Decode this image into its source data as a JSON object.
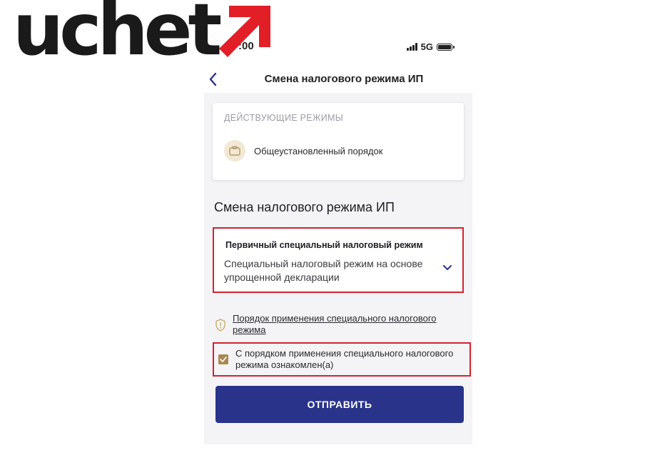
{
  "logo": {
    "text": "uchet",
    "arrow_color": "#e21e26",
    "text_color": "#1a1a1a"
  },
  "status_bar": {
    "time": ":00",
    "network": "5G"
  },
  "nav": {
    "back_icon": "chevron-left-icon",
    "title": "Смена налогового режима ИП"
  },
  "current_regimes": {
    "heading": "ДЕЙСТВУЮЩИЕ РЕЖИМЫ",
    "items": [
      {
        "icon": "regime-icon",
        "label": "Общеустановленный порядок"
      }
    ]
  },
  "form": {
    "section_title": "Смена налогового режима ИП",
    "regime_select": {
      "label": "Первичный специальный налоговый режим",
      "value": "Специальный налоговый режим на основе упрощенной декларации",
      "icon": "chevron-down-icon"
    },
    "rules_link": {
      "icon": "shield-icon",
      "text": "Порядок применения специального налогового режима"
    },
    "acknowledge_checkbox": {
      "checked": true,
      "label": "С порядком применения специального налогового режима ознакомлен(а)"
    },
    "submit_label": "ОТПРАВИТЬ"
  },
  "colors": {
    "accent": "#29338a",
    "highlight_border": "#d4222e",
    "checkbox": "#a7884f",
    "text": "#1d1d25",
    "muted": "#9c9ca6"
  }
}
